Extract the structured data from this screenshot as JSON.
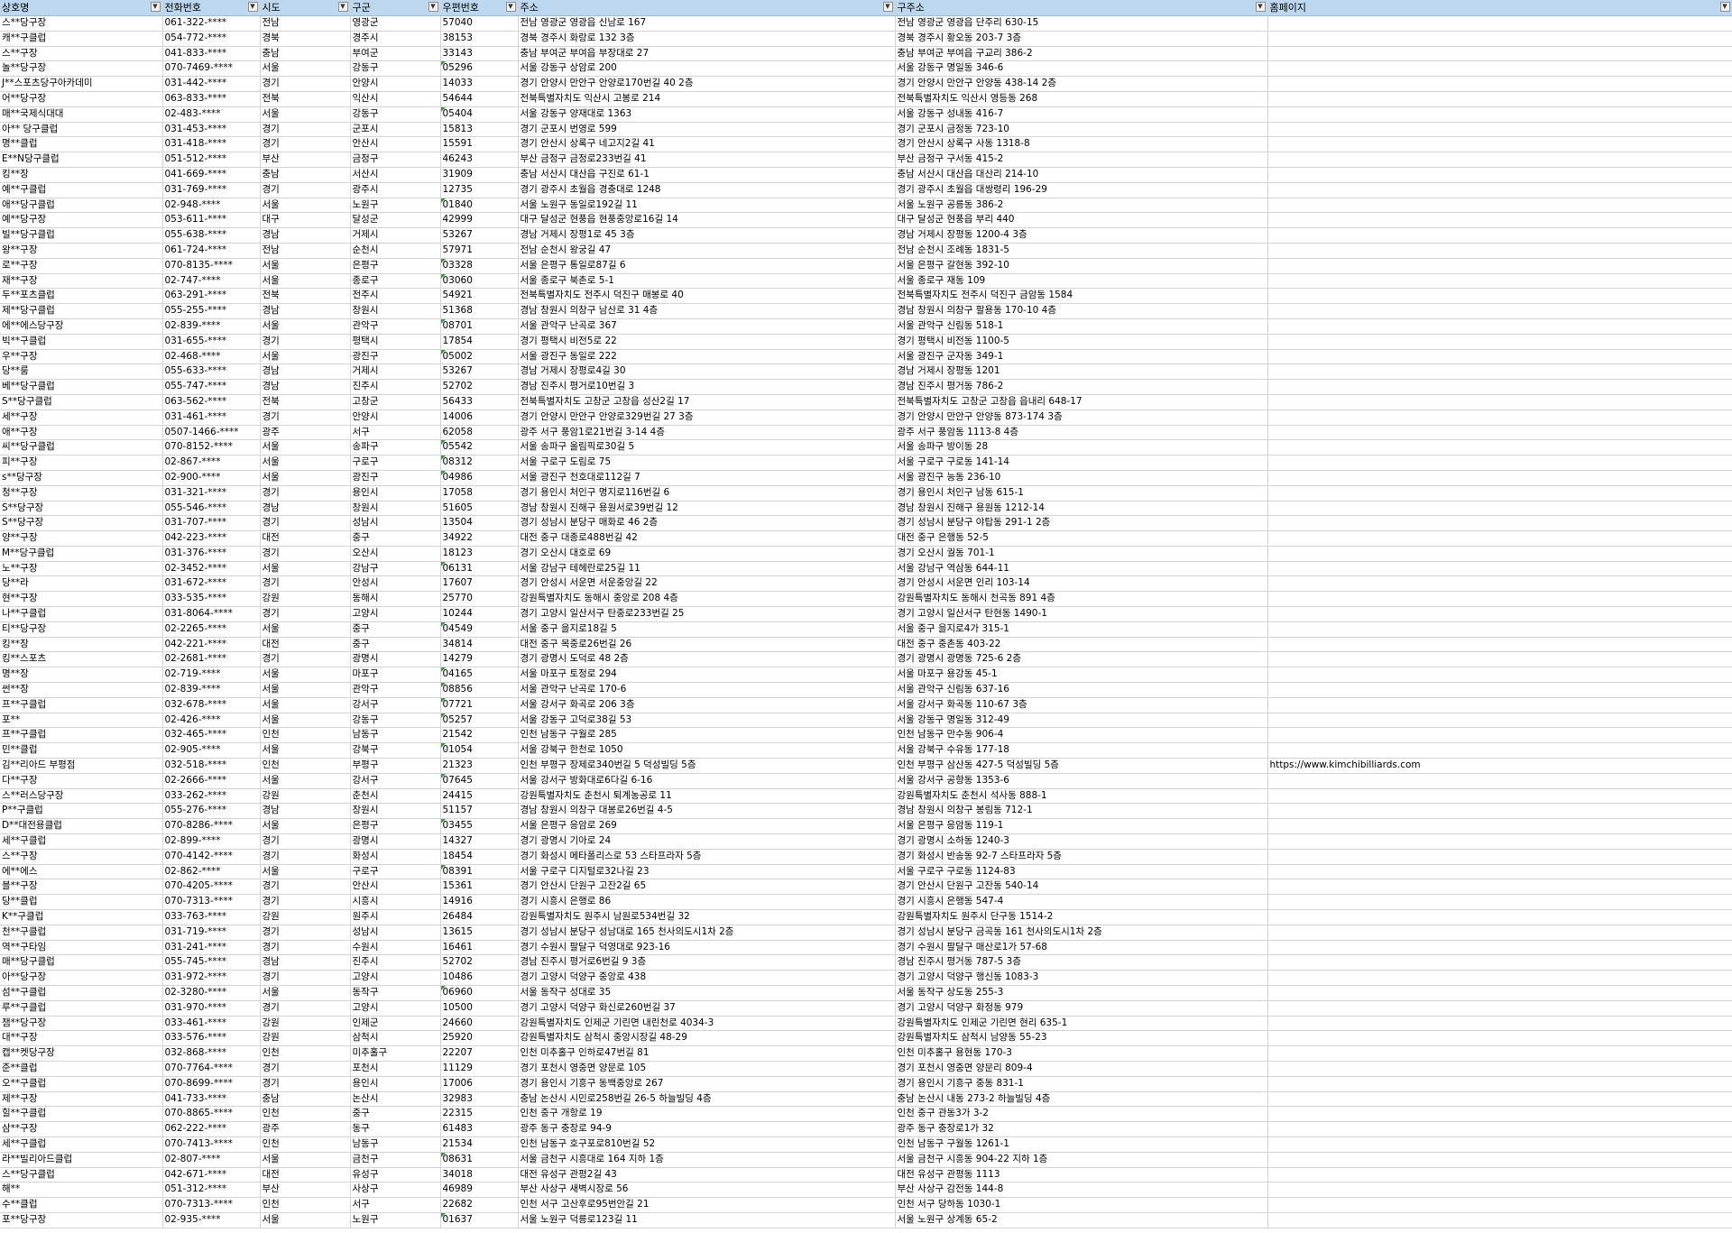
{
  "headers": [
    "상호명",
    "전화번호",
    "시도",
    "구군",
    "우편번호",
    "주소",
    "구주소",
    "홈페이지"
  ],
  "rows": [
    [
      "스**당구장",
      "061-322-****",
      "전남",
      "영광군",
      "57040",
      "전남 영광군 영광읍 신남로 167",
      "전남 영광군 영광읍 단주리 630-15",
      ""
    ],
    [
      "캐**구클럽",
      "054-772-****",
      "경북",
      "경주시",
      "38153",
      "경북 경주시 화랑로 132 3층",
      "경북 경주시 황오동 203-7 3층",
      ""
    ],
    [
      "스**구장",
      "041-833-****",
      "충남",
      "부여군",
      "33143",
      "충남 부여군 부여읍 부장대로 27",
      "충남 부여군 부여읍 구교리 386-2",
      ""
    ],
    [
      "놀**당구장",
      "070-7469-****",
      "서울",
      "강동구",
      "05296",
      "서울 강동구 상암로 200",
      "서울 강동구 명일동 346-6",
      ""
    ],
    [
      "J**스포츠당구아카데미",
      "031-442-****",
      "경기",
      "안양시",
      "14033",
      "경기 안양시 만안구 안양로170번길 40 2층",
      "경기 안양시 만안구 안양동 438-14 2층",
      ""
    ],
    [
      "어**당구장",
      "063-833-****",
      "전북",
      "익산시",
      "54644",
      "전북특별자치도 익산시 고봉로 214",
      "전북특별자치도 익산시 영등동 268",
      ""
    ],
    [
      "매**국제식대대",
      "02-483-****",
      "서울",
      "강동구",
      "05404",
      "서울 강동구 양재대로 1363",
      "서울 강동구 성내동 416-7",
      ""
    ],
    [
      "아** 당구클럽",
      "031-453-****",
      "경기",
      "군포시",
      "15813",
      "경기 군포시 번영로 599",
      "경기 군포시 금정동 723-10",
      ""
    ],
    [
      "명**클럽",
      "031-418-****",
      "경기",
      "안산시",
      "15591",
      "경기 안산시 상록구 네고지2길 41",
      "경기 안산시 상록구 사동 1318-8",
      ""
    ],
    [
      "E**N당구클럽",
      "051-512-****",
      "부산",
      "금정구",
      "46243",
      "부산 금정구 금정로233번길 41",
      "부산 금정구 구서동 415-2",
      ""
    ],
    [
      "킹**장",
      "041-669-****",
      "충남",
      "서산시",
      "31909",
      "충남 서산시 대산읍 구진로 61-1",
      "충남 서산시 대산읍 대산리 214-10",
      ""
    ],
    [
      "예**구클럽",
      "031-769-****",
      "경기",
      "광주시",
      "12735",
      "경기 광주시 초월읍 경충대로 1248",
      "경기 광주시 초월읍 대쌍령리 196-29",
      ""
    ],
    [
      "애**당구클럽",
      "02-948-****",
      "서울",
      "노원구",
      "01840",
      "서울 노원구 동일로192길 11",
      "서울 노원구 공릉동 386-2",
      ""
    ],
    [
      "예**당구장",
      "053-611-****",
      "대구",
      "달성군",
      "42999",
      "대구 달성군 현풍읍 현풍중앙로16길 14",
      "대구 달성군 현풍읍 부리 440",
      ""
    ],
    [
      "빌**당구클럽",
      "055-638-****",
      "경남",
      "거제시",
      "53267",
      "경남 거제시 장평1로 45 3층",
      "경남 거제시 장평동 1200-4 3층",
      ""
    ],
    [
      "왕**구장",
      "061-724-****",
      "전남",
      "순천시",
      "57971",
      "전남 순천시 왕궁길 47",
      "전남 순천시 조례동 1831-5",
      ""
    ],
    [
      "로**구장",
      "070-8135-****",
      "서울",
      "은평구",
      "03328",
      "서울 은평구 통일로87길 6",
      "서울 은평구 갈현동 392-10",
      ""
    ],
    [
      "재**구장",
      "02-747-****",
      "서울",
      "종로구",
      "03060",
      "서울 종로구 북촌로 5-1",
      "서울 종로구 재동 109",
      ""
    ],
    [
      "두**포츠클럽",
      "063-291-****",
      "전북",
      "전주시",
      "54921",
      "전북특별자치도 전주시 덕진구 매봉로 40",
      "전북특별자치도 전주시 덕진구 금암동 1584",
      ""
    ],
    [
      "제**당구클럽",
      "055-255-****",
      "경남",
      "창원시",
      "51368",
      "경남 창원시 의창구 남산로 31 4층",
      "경남 창원시 의창구 팔용동 170-10 4층",
      ""
    ],
    [
      "에**에스당구장",
      "02-839-****",
      "서울",
      "관악구",
      "08701",
      "서울 관악구 난곡로 367",
      "서울 관악구 신림동 518-1",
      ""
    ],
    [
      "빅**구클럽",
      "031-655-****",
      "경기",
      "평택시",
      "17854",
      "경기 평택시 비전5로 22",
      "경기 평택시 비전동 1100-5",
      ""
    ],
    [
      "우**구장",
      "02-468-****",
      "서울",
      "광진구",
      "05002",
      "서울 광진구 동일로 222",
      "서울 광진구 군자동 349-1",
      ""
    ],
    [
      "당**룸",
      "055-633-****",
      "경남",
      "거제시",
      "53267",
      "경남 거제시 장평로4길 30",
      "경남 거제시 장평동 1201",
      ""
    ],
    [
      "베**당구클럽",
      "055-747-****",
      "경남",
      "진주시",
      "52702",
      "경남 진주시 평거로10번길 3",
      "경남 진주시 평거동 786-2",
      ""
    ],
    [
      "S**당구클럽",
      "063-562-****",
      "전북",
      "고창군",
      "56433",
      "전북특별자치도 고창군 고창읍 성산2길 17",
      "전북특별자치도 고창군 고창읍 읍내리 648-17",
      ""
    ],
    [
      "세**구장",
      "031-461-****",
      "경기",
      "안양시",
      "14006",
      "경기 안양시 만안구 안양로329번길 27 3층",
      "경기 안양시 만안구 안양동 873-174 3층",
      ""
    ],
    [
      "애**구장",
      "0507-1466-****",
      "광주",
      "서구",
      "62058",
      "광주 서구 풍암1로21번길 3-14 4층",
      "광주 서구 풍암동 1113-8 4층",
      ""
    ],
    [
      "씨**당구클럽",
      "070-8152-****",
      "서울",
      "송파구",
      "05542",
      "서울 송파구 올림픽로30길 5",
      "서울 송파구 방이동 28",
      ""
    ],
    [
      "피**구장",
      "02-867-****",
      "서울",
      "구로구",
      "08312",
      "서울 구로구 도림로 75",
      "서울 구로구 구로동 141-14",
      ""
    ],
    [
      "s**당구장",
      "02-900-****",
      "서울",
      "광진구",
      "04986",
      "서울 광진구 천호대로112길 7",
      "서울 광진구 능동 236-10",
      ""
    ],
    [
      "청**구장",
      "031-321-****",
      "경기",
      "용인시",
      "17058",
      "경기 용인시 처인구 명지로116번길 6",
      "경기 용인시 처인구 남동 615-1",
      ""
    ],
    [
      "S**당구장",
      "055-546-****",
      "경남",
      "창원시",
      "51605",
      "경남 창원시 진해구 용원서로39번길 12",
      "경남 창원시 진해구 용원동 1212-14",
      ""
    ],
    [
      "S**당구장",
      "031-707-****",
      "경기",
      "성남시",
      "13504",
      "경기 성남시 분당구 매화로 46 2층",
      "경기 성남시 분당구 야탑동 291-1 2층",
      ""
    ],
    [
      "양**구장",
      "042-223-****",
      "대전",
      "중구",
      "34922",
      "대전 중구 대종로488번길 42",
      "대전 중구 은행동 52-5",
      ""
    ],
    [
      "M**당구클럽",
      "031-376-****",
      "경기",
      "오산시",
      "18123",
      "경기 오산시 대호로 69",
      "경기 오산시 궐동 701-1",
      ""
    ],
    [
      "노**구장",
      "02-3452-****",
      "서울",
      "강남구",
      "06131",
      "서울 강남구 테헤란로25길 11",
      "서울 강남구 역삼동 644-11",
      ""
    ],
    [
      "당**라",
      "031-672-****",
      "경기",
      "안성시",
      "17607",
      "경기 안성시 서운면 서운중앙길 22",
      "경기 안성시 서운면 인리 103-14",
      ""
    ],
    [
      "현**구장",
      "033-535-****",
      "강원",
      "동해시",
      "25770",
      "강원특별자치도 동해시 중앙로 208 4층",
      "강원특별자치도 동해시 천곡동 891 4층",
      ""
    ],
    [
      "나**구클럽",
      "031-8064-****",
      "경기",
      "고양시",
      "10244",
      "경기 고양시 일산서구 탄중로233번길 25",
      "경기 고양시 일산서구 탄현동 1490-1",
      ""
    ],
    [
      "티**당구장",
      "02-2265-****",
      "서울",
      "중구",
      "04549",
      "서울 중구 을지로18길 5",
      "서울 중구 을지로4가 315-1",
      ""
    ],
    [
      "킹**장",
      "042-221-****",
      "대전",
      "중구",
      "34814",
      "대전 중구 목중로26번길 26",
      "대전 중구 중촌동 403-22",
      ""
    ],
    [
      "킹**스포츠",
      "02-2681-****",
      "경기",
      "광명시",
      "14279",
      "경기 광명시 도덕로 48 2층",
      "경기 광명시 광명동 725-6 2층",
      ""
    ],
    [
      "명**장",
      "02-719-****",
      "서울",
      "마포구",
      "04165",
      "서울 마포구 토정로 294",
      "서울 마포구 용강동 45-1",
      ""
    ],
    [
      "썬**장",
      "02-839-****",
      "서울",
      "관악구",
      "08856",
      "서울 관악구 난곡로 170-6",
      "서울 관악구 신림동 637-16",
      ""
    ],
    [
      "프**구클럽",
      "032-678-****",
      "서울",
      "강서구",
      "07721",
      "서울 강서구 화곡로 206 3층",
      "서울 강서구 화곡동 110-67 3층",
      ""
    ],
    [
      "포**",
      "02-426-****",
      "서울",
      "강동구",
      "05257",
      "서울 강동구 고덕로38길 53",
      "서울 강동구 명일동 312-49",
      ""
    ],
    [
      "프**구클럽",
      "032-465-****",
      "인천",
      "남동구",
      "21542",
      "인천 남동구 구월로 285",
      "인천 남동구 만수동 906-4",
      ""
    ],
    [
      "민**클럽",
      "02-905-****",
      "서울",
      "강북구",
      "01054",
      "서울 강북구 한천로 1050",
      "서울 강북구 수유동 177-18",
      ""
    ],
    [
      "김**리아드 부평점",
      "032-518-****",
      "인천",
      "부평구",
      "21323",
      "인천 부평구 장제로340번길 5 덕성빌딩 5층",
      "인천 부평구 삼산동 427-5 덕성빌딩 5층",
      "https://www.kimchibilliards.com"
    ],
    [
      "다**구장",
      "02-2666-****",
      "서울",
      "강서구",
      "07645",
      "서울 강서구 방화대로6다길 6-16",
      "서울 강서구 공항동 1353-6",
      ""
    ],
    [
      "스**러스당구장",
      "033-262-****",
      "강원",
      "춘천시",
      "24415",
      "강원특별자치도 춘천시 퇴계농공로 11",
      "강원특별자치도 춘천시 석사동 888-1",
      ""
    ],
    [
      "P**구클럽",
      "055-276-****",
      "경남",
      "창원시",
      "51157",
      "경남 창원시 의창구 대봉로26번길 4-5",
      "경남 창원시 의창구 봉림동 712-1",
      ""
    ],
    [
      "D**대전용클럽",
      "070-8286-****",
      "서울",
      "은평구",
      "03455",
      "서울 은평구 응암로 269",
      "서울 은평구 응암동 119-1",
      ""
    ],
    [
      "세**구클럽",
      "02-899-****",
      "경기",
      "광명시",
      "14327",
      "경기 광명시 기아로 24",
      "경기 광명시 소하동 1240-3",
      ""
    ],
    [
      "스**구장",
      "070-4142-****",
      "경기",
      "화성시",
      "18454",
      "경기 화성시 메타폴리스로 53 스타프라자 5층",
      "경기 화성시 반송동 92-7 스타프라자 5층",
      ""
    ],
    [
      "에**에스",
      "02-862-****",
      "서울",
      "구로구",
      "08391",
      "서울 구로구 디지털로32나길 23",
      "서울 구로구 구로동 1124-83",
      ""
    ],
    [
      "블**구장",
      "070-4205-****",
      "경기",
      "안산시",
      "15361",
      "경기 안산시 단원구 고잔2길 65",
      "경기 안산시 단원구 고잔동 540-14",
      ""
    ],
    [
      "당**클럽",
      "070-7313-****",
      "경기",
      "시흥시",
      "14916",
      "경기 시흥시 은행로 86",
      "경기 시흥시 은행동 547-4",
      ""
    ],
    [
      "K**구클럽",
      "033-763-****",
      "강원",
      "원주시",
      "26484",
      "강원특별자치도 원주시 남원로534번길 32",
      "강원특별자치도 원주시 단구동 1514-2",
      ""
    ],
    [
      "천**구클럽",
      "031-719-****",
      "경기",
      "성남시",
      "13615",
      "경기 성남시 분당구 성남대로 165 천사의도시1차 2층",
      "경기 성남시 분당구 금곡동 161 천사의도시1차 2층",
      ""
    ],
    [
      "역**구타임",
      "031-241-****",
      "경기",
      "수원시",
      "16461",
      "경기 수원시 팔달구 덕영대로 923-16",
      "경기 수원시 팔달구 매산로1가 57-68",
      ""
    ],
    [
      "매**당구클럽",
      "055-745-****",
      "경남",
      "진주시",
      "52702",
      "경남 진주시 평거로6번길 9 3층",
      "경남 진주시 평거동 787-5 3층",
      ""
    ],
    [
      "아**당구장",
      "031-972-****",
      "경기",
      "고양시",
      "10486",
      "경기 고양시 덕양구 중앙로 438",
      "경기 고양시 덕양구 행신동 1083-3",
      ""
    ],
    [
      "섬**구클럽",
      "02-3280-****",
      "서울",
      "동작구",
      "06960",
      "서울 동작구 성대로 35",
      "서울 동작구 상도동 255-3",
      ""
    ],
    [
      "루**구클럽",
      "031-970-****",
      "경기",
      "고양시",
      "10500",
      "경기 고양시 덕양구 화신로260번길 37",
      "경기 고양시 덕양구 화정동 979",
      ""
    ],
    [
      "챔**당구장",
      "033-461-****",
      "강원",
      "인제군",
      "24660",
      "강원특별자치도 인제군 기린면 내린천로 4034-3",
      "강원특별자치도 인제군 기린면 현리 635-1",
      ""
    ],
    [
      "대**구장",
      "033-576-****",
      "강원",
      "삼척시",
      "25920",
      "강원특별자치도 삼척시 중앙시장길 48-29",
      "강원특별자치도 삼척시 남양동 55-23",
      ""
    ],
    [
      "캡**켓당구장",
      "032-868-****",
      "인천",
      "미추홀구",
      "22207",
      "인천 미추홀구 인하로47번길 81",
      "인천 미추홀구 용현동 170-3",
      ""
    ],
    [
      "준**클럽",
      "070-7764-****",
      "경기",
      "포천시",
      "11129",
      "경기 포천시 영중면 양문로 105",
      "경기 포천시 영중면 양문리 809-4",
      ""
    ],
    [
      "오**구클럽",
      "070-8699-****",
      "경기",
      "용인시",
      "17006",
      "경기 용인시 기흥구 동백중앙로 267",
      "경기 용인시 기흥구 중동 831-1",
      ""
    ],
    [
      "제**구장",
      "041-733-****",
      "충남",
      "논산시",
      "32983",
      "충남 논산시 시민로258번길 26-5 하늘빌딩 4층",
      "충남 논산시 내동 273-2 하늘빌딩 4층",
      ""
    ],
    [
      "힐**구클럽",
      "070-8865-****",
      "인천",
      "중구",
      "22315",
      "인천 중구 개항로 19",
      "인천 중구 관동3가 3-2",
      ""
    ],
    [
      "삼**구장",
      "062-222-****",
      "광주",
      "동구",
      "61483",
      "광주 동구 충장로 94-9",
      "광주 동구 충장로1가 32",
      ""
    ],
    [
      "세**구클럽",
      "070-7413-****",
      "인천",
      "남동구",
      "21534",
      "인천 남동구 호구포로810번길 52",
      "인천 남동구 구월동 1261-1",
      ""
    ],
    [
      "라**빌리아드클럽",
      "02-807-****",
      "서울",
      "금천구",
      "08631",
      "서울 금천구 시흥대로 164 지하 1층",
      "서울 금천구 시흥동 904-22 지하 1층",
      ""
    ],
    [
      "스**당구클럽",
      "042-671-****",
      "대전",
      "유성구",
      "34018",
      "대전 유성구 관평2길 43",
      "대전 유성구 관평동 1113",
      ""
    ],
    [
      "해**",
      "051-312-****",
      "부산",
      "사상구",
      "46989",
      "부산 사상구 새벽시장로 56",
      "부산 사상구 감전동 144-8",
      ""
    ],
    [
      "수**클럽",
      "070-7313-****",
      "인천",
      "서구",
      "22682",
      "인천 서구 고산후로95번안길 21",
      "인천 서구 당하동 1030-1",
      ""
    ],
    [
      "포**당구장",
      "02-935-****",
      "서울",
      "노원구",
      "01637",
      "서울 노원구 덕릉로123길 11",
      "서울 노원구 상계동 65-2",
      ""
    ]
  ],
  "icons": {
    "filter": "filter-dropdown-icon"
  },
  "colors": {
    "header_bg": "#bdd7ee",
    "grid": "#d4d4d4",
    "zip_marker": "#3a9a3a"
  }
}
